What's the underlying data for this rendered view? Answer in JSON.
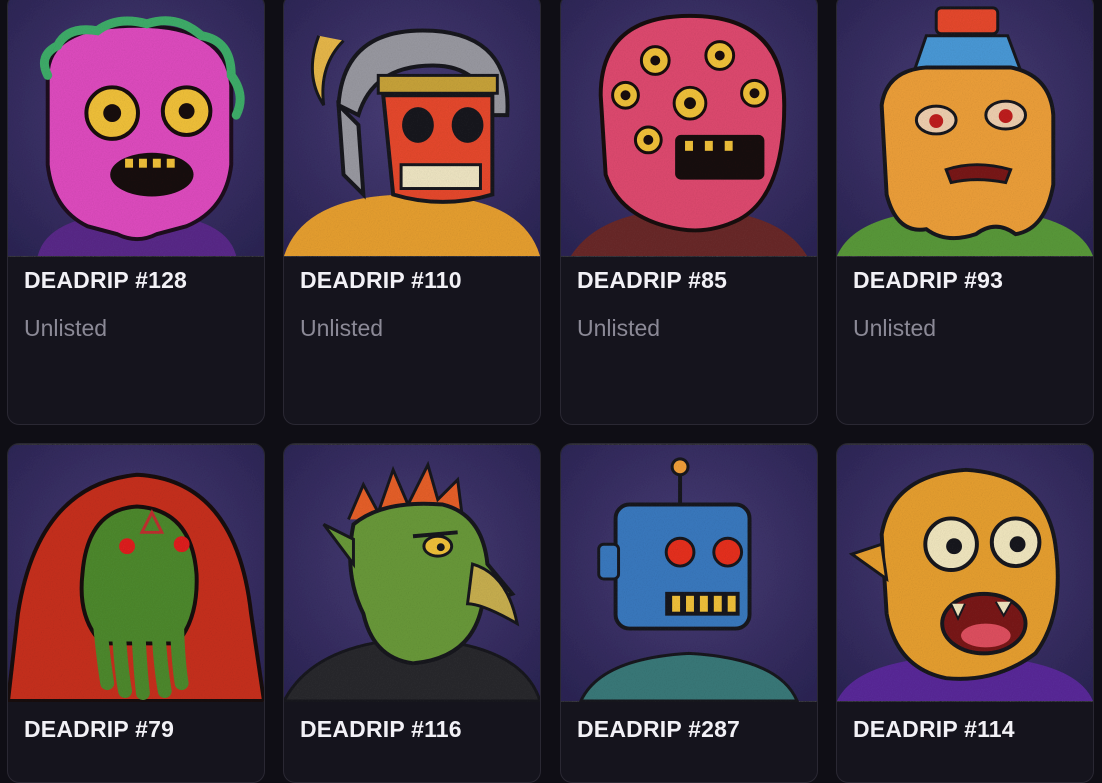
{
  "colors": {
    "page_background": "#0f0e15",
    "card_background": "#15141d",
    "card_border": "#2a2833",
    "title_text": "#f2f1f6",
    "status_text": "#8b8996"
  },
  "cards": [
    {
      "title": "DEADRIP #128",
      "status": "Unlisted",
      "character": "pink-zombie-with-green-slime"
    },
    {
      "title": "DEADRIP #110",
      "status": "Unlisted",
      "character": "red-skull-knight-helmet"
    },
    {
      "title": "DEADRIP #85",
      "status": "Unlisted",
      "character": "pink-many-eyed-blob"
    },
    {
      "title": "DEADRIP #93",
      "status": "Unlisted",
      "character": "orange-slime-bottle-head"
    },
    {
      "title": "DEADRIP #79",
      "status": "",
      "character": "green-tentacle-face-red-hood"
    },
    {
      "title": "DEADRIP #116",
      "status": "",
      "character": "green-goblin-with-spikes"
    },
    {
      "title": "DEADRIP #287",
      "status": "",
      "character": "blue-robot"
    },
    {
      "title": "DEADRIP #114",
      "status": "",
      "character": "yellow-furry-monster"
    }
  ]
}
